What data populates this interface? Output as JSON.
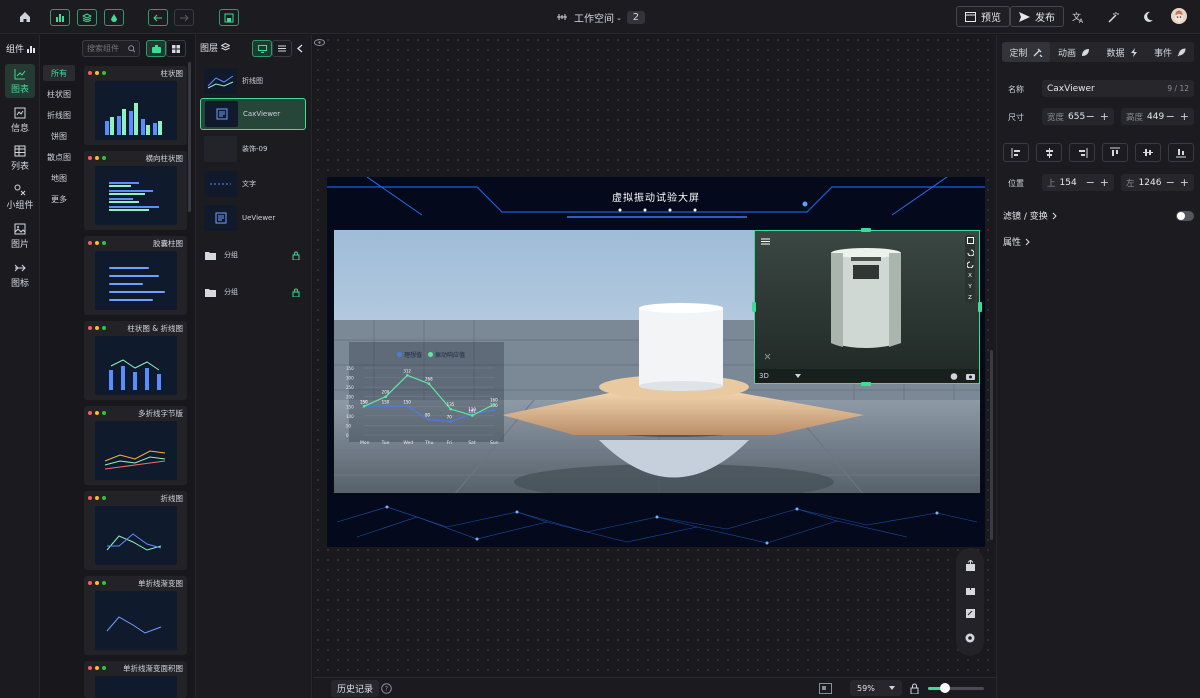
{
  "topbar": {
    "workspace_label": "工作空间 -",
    "workspace_num": "2",
    "preview_label": "预览",
    "publish_label": "发布"
  },
  "left": {
    "panel_title": "组件",
    "nav": [
      "图表",
      "信息",
      "列表",
      "小组件",
      "图片",
      "图标"
    ],
    "categories": [
      "所有",
      "柱状图",
      "折线图",
      "饼图",
      "散点图",
      "地图",
      "更多"
    ],
    "search_placeholder": "搜索组件",
    "cards": [
      "柱状图",
      "横向柱状图",
      "胶囊柱图",
      "柱状图 & 折线图",
      "多折线字节版",
      "折线图",
      "单折线渐变图",
      "单折线渐变面积图"
    ]
  },
  "layers": {
    "title": "图层",
    "items": [
      "折线图",
      "CaxViewer",
      "装饰-09",
      "文字",
      "UeViewer"
    ],
    "groups": [
      "分组",
      "分组"
    ]
  },
  "screen": {
    "title": "虚拟振动试验大屏",
    "legend": [
      "理想值",
      "振动响应值"
    ],
    "y_ticks": [
      "350",
      "300",
      "250",
      "200",
      "150",
      "100",
      "50",
      "0"
    ],
    "x_ticks": [
      "Mon",
      "Tue",
      "Wed",
      "Thu",
      "Fri",
      "Sat",
      "Sun"
    ],
    "series_ideal": [
      150,
      150,
      150,
      80,
      70,
      110,
      130
    ],
    "series_resp": [
      150,
      200,
      312,
      268,
      135,
      102,
      160
    ],
    "labels_resp": [
      "150",
      "200",
      "312",
      "268",
      "135",
      "102",
      "160"
    ],
    "labels_ideal": [
      "150",
      "150",
      "150",
      "80",
      "70",
      "110",
      "130"
    ],
    "cax_mode": "3D",
    "cax_tools": [
      "X",
      "Y",
      "Z"
    ]
  },
  "bottom": {
    "history_label": "历史记录",
    "zoom": "59%",
    "zoom_level": 0.3
  },
  "right": {
    "tabs": [
      "定制",
      "动画",
      "数据",
      "事件"
    ],
    "name_label": "名称",
    "name_value": "CaxViewer",
    "name_count": "9 / 12",
    "size_label": "尺寸",
    "width_pre": "宽度",
    "width_val": "655",
    "height_pre": "高度",
    "height_val": "449",
    "pos_label": "位置",
    "top_pre": "上",
    "top_val": "154",
    "left_pre": "左",
    "left_val": "1246",
    "filter_label": "滤镜 / 变换",
    "props_label": "属性"
  },
  "colors": {
    "accent": "#3ddc97",
    "bg": "#18181c",
    "panel": "#1c1c20"
  }
}
